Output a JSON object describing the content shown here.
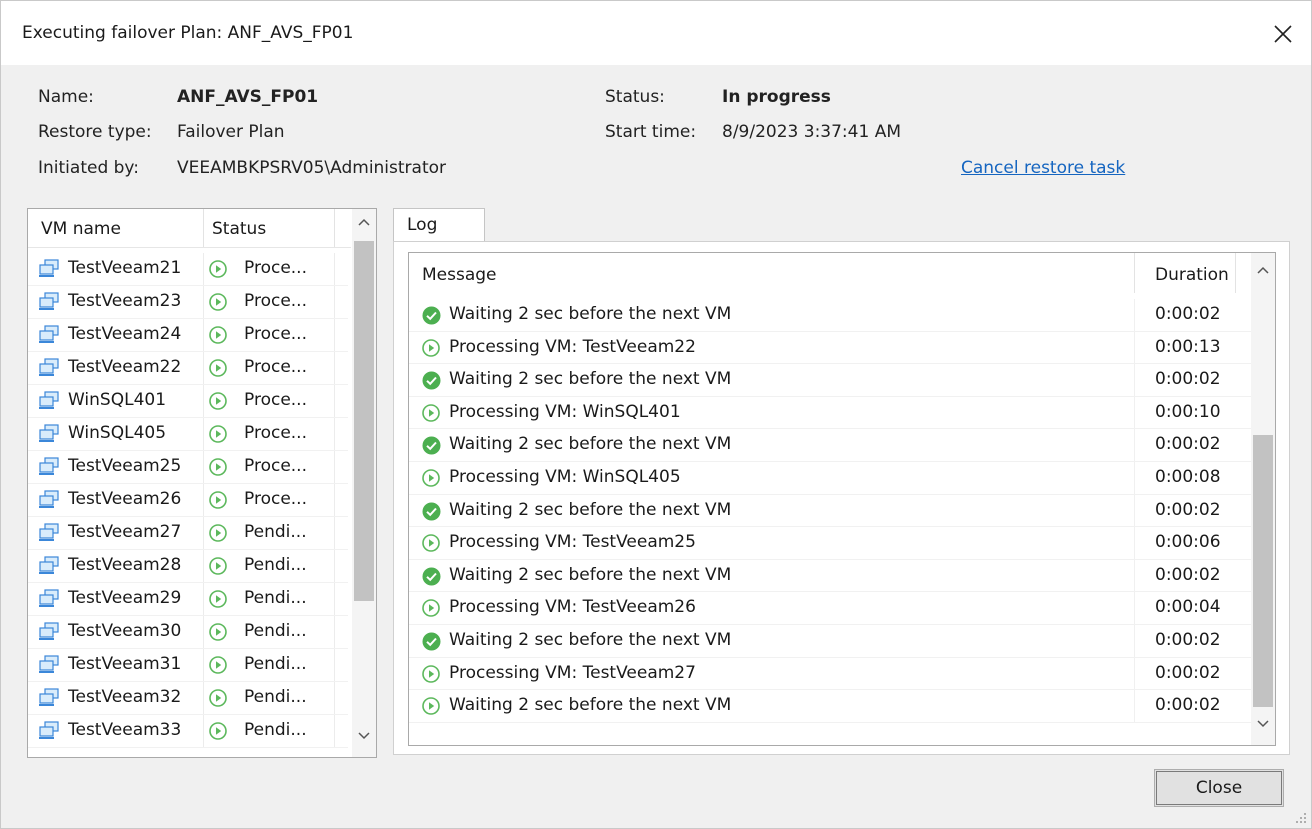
{
  "window": {
    "title": "Executing failover Plan: ANF_AVS_FP01"
  },
  "info": {
    "name_label": "Name:",
    "name_value": "ANF_AVS_FP01",
    "restore_type_label": "Restore type:",
    "restore_type_value": "Failover Plan",
    "initiated_by_label": "Initiated by:",
    "initiated_by_value": "VEEAMBKPSRV05\\Administrator",
    "status_label": "Status:",
    "status_value": "In progress",
    "start_time_label": "Start time:",
    "start_time_value": "8/9/2023 3:37:41 AM",
    "cancel_link": "Cancel restore task"
  },
  "vm_list": {
    "columns": [
      "VM name",
      "Status"
    ],
    "rows": [
      {
        "name": "TestVeeam21",
        "status": "Proce..."
      },
      {
        "name": "TestVeeam23",
        "status": "Proce..."
      },
      {
        "name": "TestVeeam24",
        "status": "Proce..."
      },
      {
        "name": "TestVeeam22",
        "status": "Proce..."
      },
      {
        "name": "WinSQL401",
        "status": "Proce..."
      },
      {
        "name": "WinSQL405",
        "status": "Proce..."
      },
      {
        "name": "TestVeeam25",
        "status": "Proce..."
      },
      {
        "name": "TestVeeam26",
        "status": "Proce..."
      },
      {
        "name": "TestVeeam27",
        "status": "Pendi..."
      },
      {
        "name": "TestVeeam28",
        "status": "Pendi..."
      },
      {
        "name": "TestVeeam29",
        "status": "Pendi..."
      },
      {
        "name": "TestVeeam30",
        "status": "Pendi..."
      },
      {
        "name": "TestVeeam31",
        "status": "Pendi..."
      },
      {
        "name": "TestVeeam32",
        "status": "Pendi..."
      },
      {
        "name": "TestVeeam33",
        "status": "Pendi..."
      }
    ]
  },
  "log": {
    "tab_label": "Log",
    "columns": [
      "Message",
      "Duration"
    ],
    "rows": [
      {
        "icon": "success-check-icon",
        "message": "Waiting 2 sec before the next VM",
        "duration": "0:00:02"
      },
      {
        "icon": "play-circle-icon",
        "message": "Processing VM: TestVeeam22",
        "duration": "0:00:13"
      },
      {
        "icon": "success-check-icon",
        "message": "Waiting 2 sec before the next VM",
        "duration": "0:00:02"
      },
      {
        "icon": "play-circle-icon",
        "message": "Processing VM: WinSQL401",
        "duration": "0:00:10"
      },
      {
        "icon": "success-check-icon",
        "message": "Waiting 2 sec before the next VM",
        "duration": "0:00:02"
      },
      {
        "icon": "play-circle-icon",
        "message": "Processing VM: WinSQL405",
        "duration": "0:00:08"
      },
      {
        "icon": "success-check-icon",
        "message": "Waiting 2 sec before the next VM",
        "duration": "0:00:02"
      },
      {
        "icon": "play-circle-icon",
        "message": "Processing VM: TestVeeam25",
        "duration": "0:00:06"
      },
      {
        "icon": "success-check-icon",
        "message": "Waiting 2 sec before the next VM",
        "duration": "0:00:02"
      },
      {
        "icon": "play-circle-icon",
        "message": "Processing VM: TestVeeam26",
        "duration": "0:00:04"
      },
      {
        "icon": "success-check-icon",
        "message": "Waiting 2 sec before the next VM",
        "duration": "0:00:02"
      },
      {
        "icon": "play-circle-icon",
        "message": "Processing VM: TestVeeam27",
        "duration": "0:00:02"
      },
      {
        "icon": "play-circle-icon",
        "message": "Waiting 2 sec before the next VM",
        "duration": "0:00:02"
      }
    ]
  },
  "buttons": {
    "close_label": "Close"
  },
  "colors": {
    "success_green": "#4caf50",
    "progress_green": "#5cb85c",
    "link_blue": "#1565c0",
    "vm_icon_blue": "#3b87d9"
  }
}
